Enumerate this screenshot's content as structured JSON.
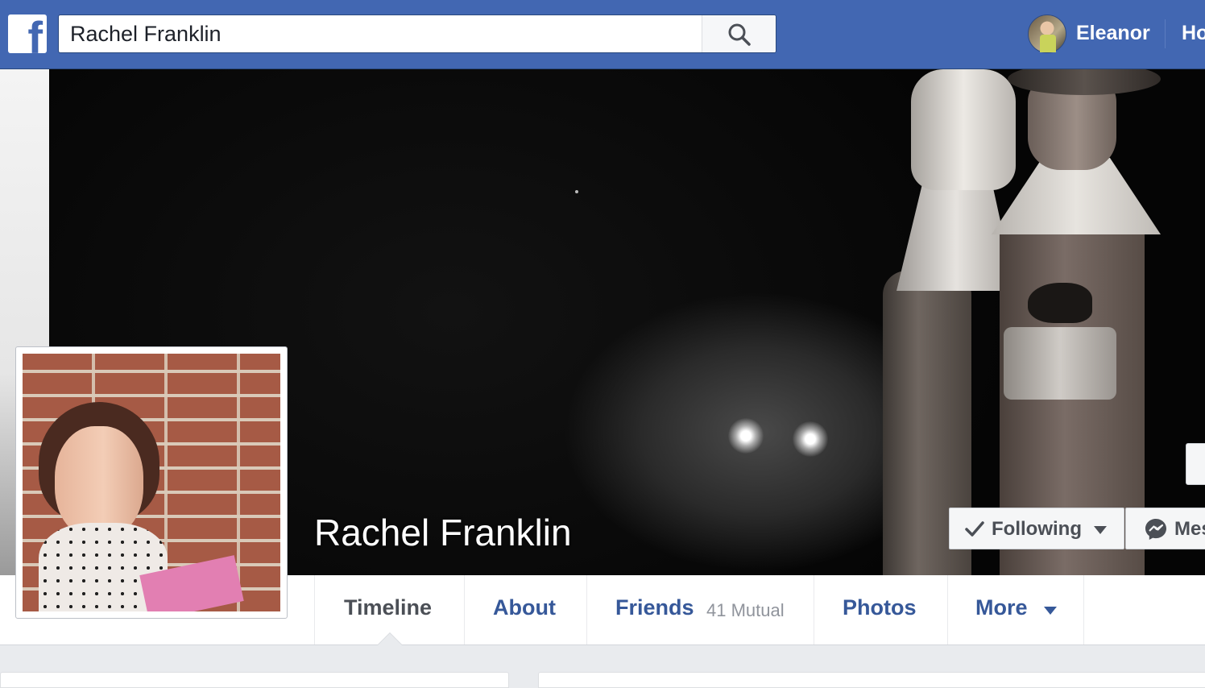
{
  "header": {
    "logo": "facebook-logo",
    "search": {
      "value": "Rachel Franklin",
      "placeholder": "Search"
    },
    "user": {
      "name": "Eleanor"
    },
    "home_label": "Home"
  },
  "profile": {
    "name": "Rachel Franklin",
    "following_label": "Following",
    "message_label": "Message"
  },
  "nav": {
    "tabs": [
      {
        "label": "Timeline",
        "active": true
      },
      {
        "label": "About"
      },
      {
        "label": "Friends",
        "extra": "41 Mutual"
      },
      {
        "label": "Photos"
      },
      {
        "label": "More"
      }
    ]
  },
  "colors": {
    "brand": "#4267b2",
    "link": "#365899",
    "muted": "#90949c"
  }
}
